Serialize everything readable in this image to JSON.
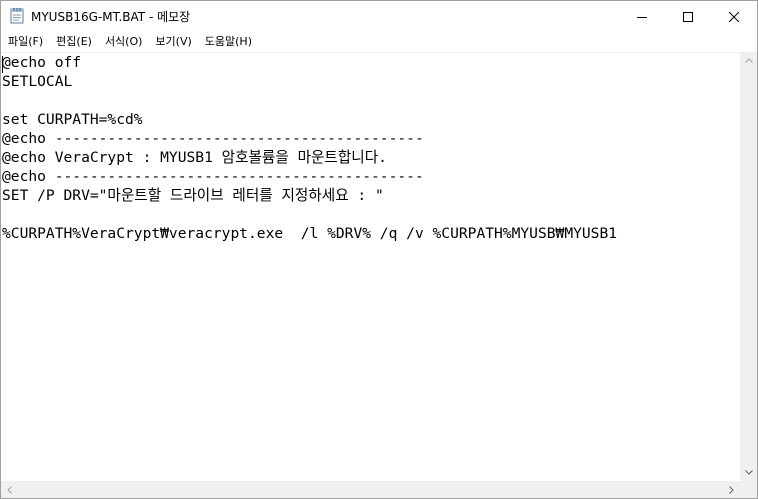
{
  "window": {
    "title": "MYUSB16G-MT.BAT - 메모장",
    "app_icon": "notepad-icon",
    "controls": {
      "minimize_icon": "minimize-icon",
      "maximize_icon": "maximize-icon",
      "close_icon": "close-icon"
    }
  },
  "menu": {
    "items": [
      {
        "label": "파일(F)"
      },
      {
        "label": "편집(E)"
      },
      {
        "label": "서식(O)"
      },
      {
        "label": "보기(V)"
      },
      {
        "label": "도움말(H)"
      }
    ]
  },
  "editor": {
    "lines": [
      "@echo off",
      "SETLOCAL",
      "",
      "set CURPATH=%cd%",
      "@echo ------------------------------------------",
      "@echo VeraCrypt : MYUSB1 암호볼륨을 마운트합니다.",
      "@echo ------------------------------------------",
      "SET /P DRV=\"마운트할 드라이브 레터를 지정하세요 : \"",
      "",
      "%CURPATH%VeraCrypt₩veracrypt.exe  /l %DRV% /q /v %CURPATH%MYUSB₩MYUSB1"
    ]
  },
  "colors": {
    "window_border": "#a0a0a0",
    "scrollbar_track": "#f0f0f0",
    "text": "#000000"
  }
}
